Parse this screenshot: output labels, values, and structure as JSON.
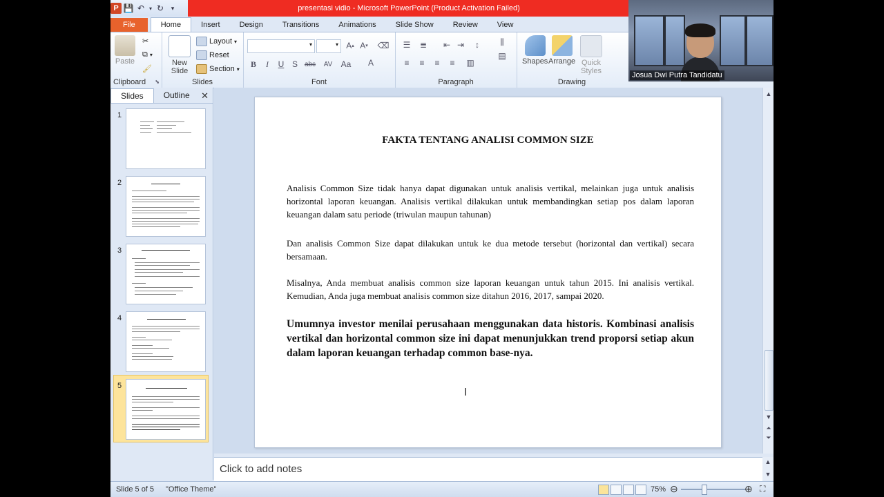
{
  "window": {
    "title": "presentasi vidio  -  Microsoft PowerPoint (Product Activation Failed)"
  },
  "ribbon_tabs": [
    "File",
    "Home",
    "Insert",
    "Design",
    "Transitions",
    "Animations",
    "Slide Show",
    "Review",
    "View"
  ],
  "ribbon": {
    "clipboard": {
      "label": "Clipboard",
      "paste": "Paste"
    },
    "slides": {
      "label": "Slides",
      "new_slide_1": "New",
      "new_slide_2": "Slide",
      "layout": "Layout",
      "reset": "Reset",
      "section": "Section"
    },
    "font": {
      "label": "Font"
    },
    "paragraph": {
      "label": "Paragraph"
    },
    "drawing": {
      "label": "Drawing",
      "shapes": "Shapes",
      "arrange": "Arrange",
      "quick_styles_1": "Quick",
      "quick_styles_2": "Styles"
    }
  },
  "webcam": {
    "name": "Josua Dwi Putra Tandidatu"
  },
  "left_pane": {
    "tabs": [
      "Slides",
      "Outline"
    ],
    "slide_numbers": [
      "1",
      "2",
      "3",
      "4",
      "5"
    ]
  },
  "slide": {
    "title": "FAKTA TENTANG ANALISI  COMMON SIZE",
    "paragraphs": [
      "Analisis Common Size tidak hanya dapat digunakan untuk analisis vertikal, melainkan juga untuk analisis horizontal laporan keuangan. Analisis vertikal dilakukan untuk membandingkan setiap pos dalam laporan keuangan dalam satu periode (triwulan maupun tahunan)",
      "Dan analisis Common Size dapat dilakukan untuk ke dua metode tersebut (horizontal dan vertikal) secara bersamaan.",
      "Misalnya, Anda membuat analisis common size laporan keuangan untuk tahun 2015. Ini analisis vertikal. Kemudian, Anda juga membuat analisis common size ditahun 2016, 2017, sampai 2020.",
      "Umumnya investor menilai perusahaan menggunakan data historis. Kombinasi analisis vertikal dan horizontal common size ini dapat menunjukkan trend proporsi setiap akun dalam laporan keuangan terhadap common base-nya."
    ]
  },
  "notes": {
    "placeholder": "Click to add notes"
  },
  "status_bar": {
    "slide_info": "Slide 5 of 5",
    "theme": "\"Office Theme\"",
    "zoom": "75%"
  },
  "colors": {
    "file_tab": "#e8622c",
    "title_bar_alert": "#ef2c22",
    "selected_thumb": "#fde49b"
  }
}
